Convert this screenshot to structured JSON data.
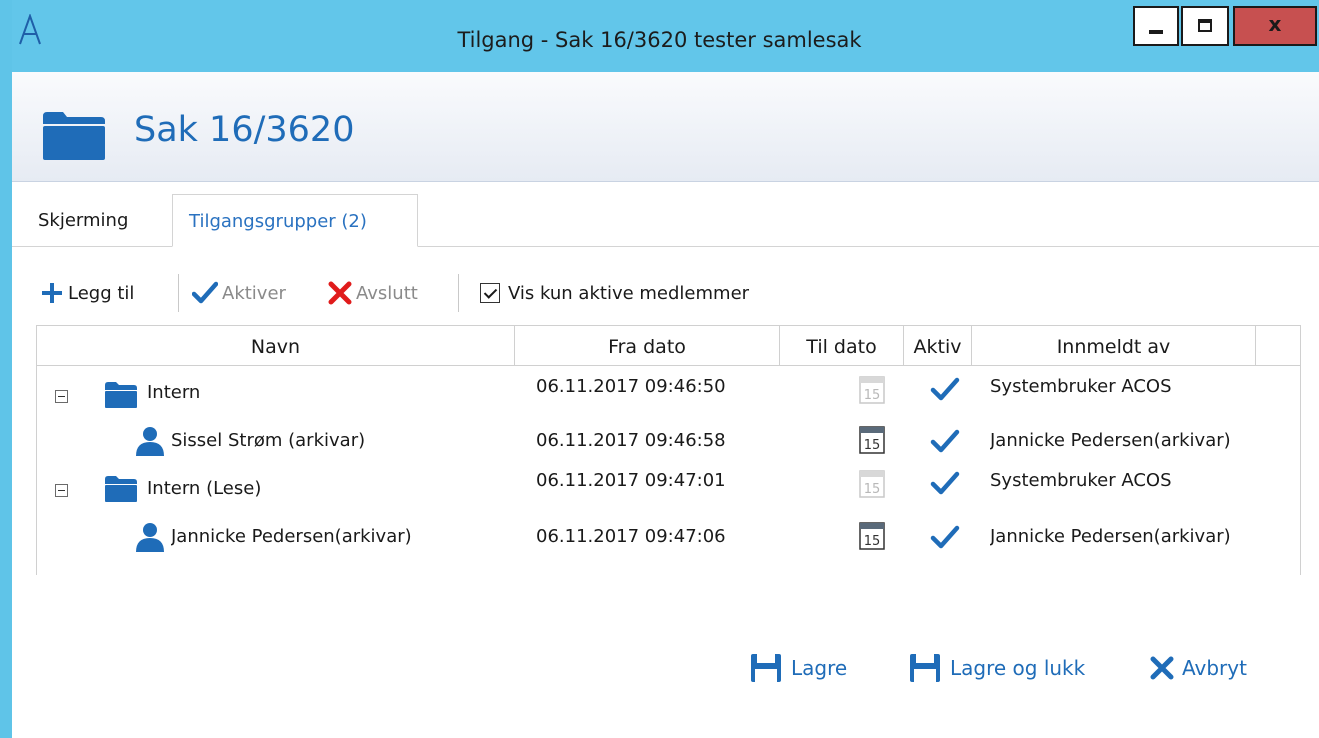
{
  "window": {
    "title": "Tilgang - Sak 16/3620 tester samlesak",
    "close_label": "x"
  },
  "header": {
    "title": "Sak 16/3620"
  },
  "tabs": [
    {
      "label": "Skjerming",
      "active": false
    },
    {
      "label": "Tilgangsgrupper (2)",
      "active": true
    }
  ],
  "toolbar": {
    "add_label": "Legg til",
    "activate_label": "Aktiver",
    "end_label": "Avslutt",
    "active_only_label": "Vis kun aktive medlemmer",
    "active_only_checked": true
  },
  "grid": {
    "columns": [
      "Navn",
      "Fra dato",
      "Til dato",
      "Aktiv",
      "Innmeldt av"
    ],
    "rows": [
      {
        "type": "group",
        "name": "Intern",
        "from": "06.11.2017 09:46:50",
        "calendar_day": "15",
        "active": true,
        "registered_by": "Systembruker ACOS"
      },
      {
        "type": "user",
        "name": "Sissel Strøm (arkivar)",
        "from": "06.11.2017 09:46:58",
        "calendar_day": "15",
        "active": true,
        "registered_by": "Jannicke Pedersen(arkivar)"
      },
      {
        "type": "group",
        "name": "Intern (Lese)",
        "from": "06.11.2017 09:47:01",
        "calendar_day": "15",
        "active": true,
        "registered_by": "Systembruker ACOS"
      },
      {
        "type": "user",
        "name": "Jannicke Pedersen(arkivar)",
        "from": "06.11.2017 09:47:06",
        "calendar_day": "15",
        "active": true,
        "registered_by": "Jannicke Pedersen(arkivar)"
      }
    ]
  },
  "footer": {
    "save_label": "Lagre",
    "save_close_label": "Lagre og lukk",
    "cancel_label": "Avbryt"
  },
  "colors": {
    "titlebar": "#62c6ea",
    "accent": "#1f6cb8",
    "close": "#c75050",
    "disabled": "#8a8a8a"
  }
}
